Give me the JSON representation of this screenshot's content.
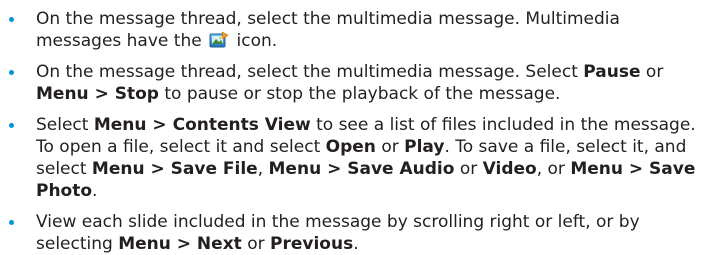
{
  "colors": {
    "bullet": "#0096d6",
    "text": "#231f20"
  },
  "items": [
    {
      "t1": "On the message thread, select the multimedia message. Multimedia messages have the",
      "icon": "multimedia-message-icon",
      "t2": " icon."
    },
    {
      "t1": "On the message thread, select the multimedia message. Select ",
      "b1": "Pause",
      "t2": " or ",
      "b2": "Menu > Stop",
      "t3": " to pause or stop the playback of the message."
    },
    {
      "t1": "Select ",
      "b1": "Menu > Contents View",
      "t2": " to see a list of files included in the message. To open a file, select it and select ",
      "b2": "Open",
      "t3": " or ",
      "b3": "Play",
      "t4": ". To save a file, select it, and select ",
      "b4": "Menu > Save File",
      "t5": ", ",
      "b5": "Menu > Save Audio",
      "t6": " or ",
      "b6": "Video",
      "t7": ", or ",
      "b7": "Menu > Save Photo",
      "t8": "."
    },
    {
      "t1": "View each slide included in the message by scrolling right or left, or by selecting ",
      "b1": "Menu > Next",
      "t2": " or ",
      "b2": "Previous",
      "t3": "."
    }
  ]
}
